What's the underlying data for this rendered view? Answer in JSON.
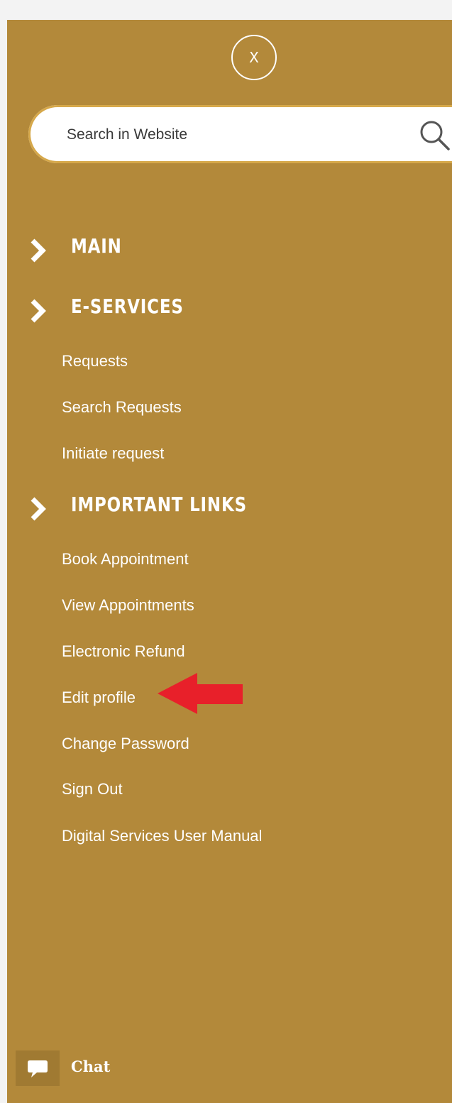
{
  "close_button": {
    "label": "X"
  },
  "search": {
    "placeholder": "Search in Website"
  },
  "sections": [
    {
      "label": "MAIN"
    },
    {
      "label": "E-SERVICES"
    },
    {
      "label": "IMPORTANT LINKS"
    }
  ],
  "eservices_links": [
    "Requests",
    "Search Requests",
    "Initiate request"
  ],
  "important_links": [
    "Book Appointment",
    "View Appointments",
    "Electronic Refund",
    "Edit profile",
    "Change Password",
    "Sign Out",
    "Digital Services User Manual"
  ],
  "chat": {
    "label": "Chat"
  },
  "colors": {
    "panel": "#b3893a",
    "annotation_arrow": "#e8202a",
    "text": "#ffffff"
  },
  "icons": [
    "close-icon",
    "search-icon",
    "chevron-right-icon",
    "chat-bubble-icon",
    "red-arrow-annotation"
  ]
}
